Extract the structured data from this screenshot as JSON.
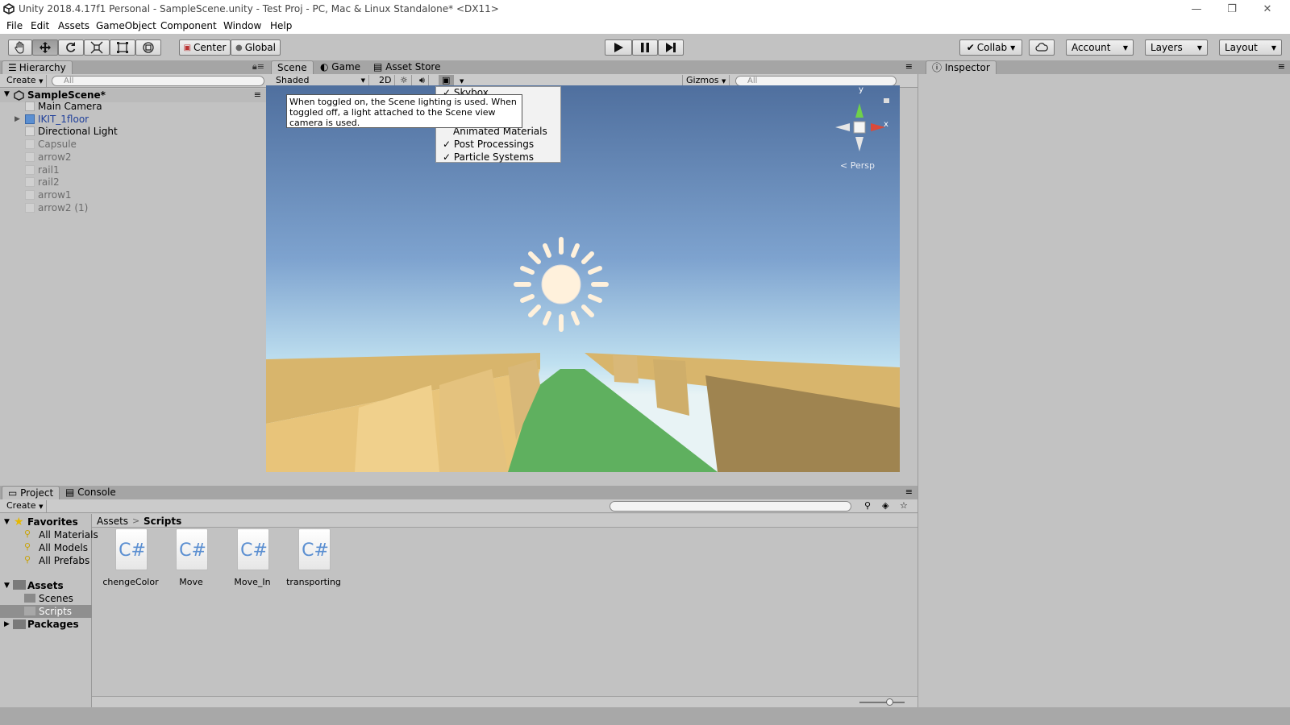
{
  "window": {
    "title": "Unity 2018.4.17f1 Personal - SampleScene.unity - Test Proj - PC, Mac & Linux Standalone* <DX11>",
    "minimize": "—",
    "restore": "❐",
    "close": "✕"
  },
  "menu": [
    "File",
    "Edit",
    "Assets",
    "GameObject",
    "Component",
    "Window",
    "Help"
  ],
  "toolbar": {
    "pivot": "Center",
    "space": "Global",
    "collab": "Collab",
    "account": "Account",
    "layers": "Layers",
    "layout": "Layout"
  },
  "hierarchy": {
    "tab": "Hierarchy",
    "create": "Create",
    "search_placeholder": "All",
    "scene": "SampleScene*",
    "items": [
      "Main Camera",
      "IKIT_1floor",
      "Directional Light",
      "Capsule",
      "arrow2",
      "rail1",
      "rail2",
      "arrow1",
      "arrow2 (1)"
    ]
  },
  "scene": {
    "tabs": [
      "Scene",
      "Game",
      "Asset Store"
    ],
    "shading": "Shaded",
    "mode2d": "2D",
    "gizmos": "Gizmos",
    "search_placeholder": "All",
    "persp": "Persp",
    "axis_x": "x",
    "axis_y": "y"
  },
  "effects_menu": {
    "items": [
      {
        "label": "Skybox",
        "checked": true
      },
      {
        "label": "Animated Materials",
        "checked": false
      },
      {
        "label": "Post Processings",
        "checked": true
      },
      {
        "label": "Particle Systems",
        "checked": true
      }
    ],
    "check": "✓"
  },
  "tooltip": "When toggled on, the Scene lighting is used. When toggled off, a light attached to the Scene view camera is used.",
  "inspector": {
    "tab": "Inspector"
  },
  "project": {
    "tabs": [
      "Project",
      "Console"
    ],
    "create": "Create",
    "favorites": "Favorites",
    "favorite_items": [
      "All Materials",
      "All Models",
      "All Prefabs"
    ],
    "assets": "Assets",
    "asset_folders": [
      "Scenes",
      "Scripts"
    ],
    "packages": "Packages",
    "breadcrumb_root": "Assets",
    "breadcrumb_sep": ">",
    "breadcrumb_current": "Scripts",
    "file_icon_text": "C#",
    "files": [
      "chengeColor",
      "Move",
      "Move_In",
      "transporting"
    ]
  },
  "zoom_slider": 0.66
}
